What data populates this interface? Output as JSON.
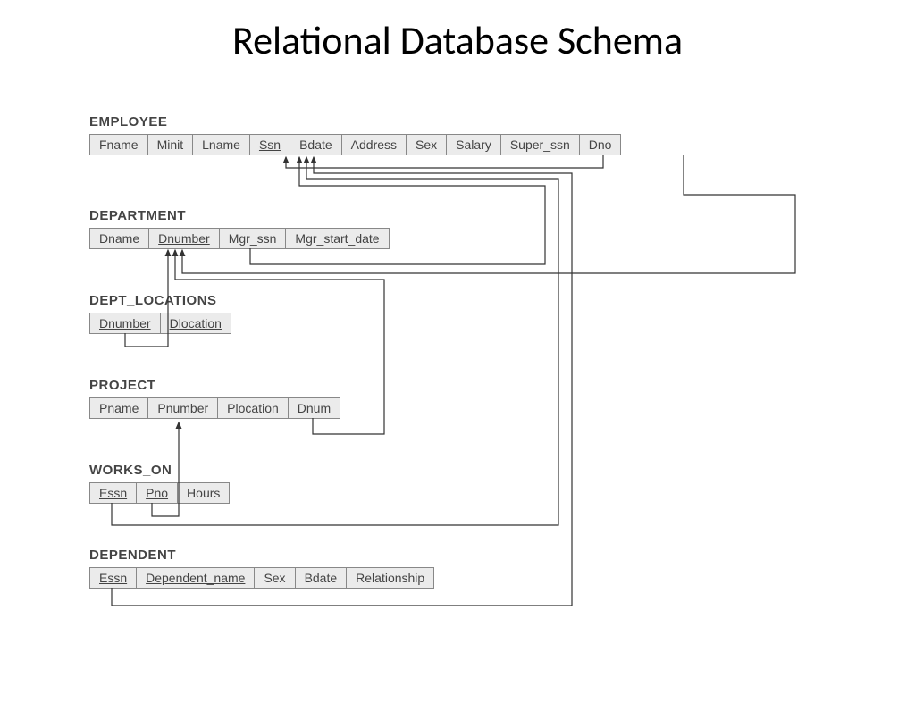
{
  "title": "Relational Database Schema",
  "tables": {
    "employee": {
      "name": "EMPLOYEE",
      "cols": [
        "Fname",
        "Minit",
        "Lname",
        "Ssn",
        "Bdate",
        "Address",
        "Sex",
        "Salary",
        "Super_ssn",
        "Dno"
      ],
      "pk": [
        "Ssn"
      ]
    },
    "department": {
      "name": "DEPARTMENT",
      "cols": [
        "Dname",
        "Dnumber",
        "Mgr_ssn",
        "Mgr_start_date"
      ],
      "pk": [
        "Dnumber"
      ]
    },
    "dept_locations": {
      "name": "DEPT_LOCATIONS",
      "cols": [
        "Dnumber",
        "Dlocation"
      ],
      "pk": [
        "Dnumber",
        "Dlocation"
      ]
    },
    "project": {
      "name": "PROJECT",
      "cols": [
        "Pname",
        "Pnumber",
        "Plocation",
        "Dnum"
      ],
      "pk": [
        "Pnumber"
      ]
    },
    "works_on": {
      "name": "WORKS_ON",
      "cols": [
        "Essn",
        "Pno",
        "Hours"
      ],
      "pk": [
        "Essn",
        "Pno"
      ]
    },
    "dependent": {
      "name": "DEPENDENT",
      "cols": [
        "Essn",
        "Dependent_name",
        "Sex",
        "Bdate",
        "Relationship"
      ],
      "pk": [
        "Essn",
        "Dependent_name"
      ]
    }
  },
  "foreign_keys": [
    {
      "from_table": "EMPLOYEE",
      "from_col": "Super_ssn",
      "to_table": "EMPLOYEE",
      "to_col": "Ssn"
    },
    {
      "from_table": "EMPLOYEE",
      "from_col": "Dno",
      "to_table": "DEPARTMENT",
      "to_col": "Dnumber"
    },
    {
      "from_table": "DEPARTMENT",
      "from_col": "Mgr_ssn",
      "to_table": "EMPLOYEE",
      "to_col": "Ssn"
    },
    {
      "from_table": "DEPT_LOCATIONS",
      "from_col": "Dnumber",
      "to_table": "DEPARTMENT",
      "to_col": "Dnumber"
    },
    {
      "from_table": "PROJECT",
      "from_col": "Dnum",
      "to_table": "DEPARTMENT",
      "to_col": "Dnumber"
    },
    {
      "from_table": "WORKS_ON",
      "from_col": "Essn",
      "to_table": "EMPLOYEE",
      "to_col": "Ssn"
    },
    {
      "from_table": "WORKS_ON",
      "from_col": "Pno",
      "to_table": "PROJECT",
      "to_col": "Pnumber"
    },
    {
      "from_table": "DEPENDENT",
      "from_col": "Essn",
      "to_table": "EMPLOYEE",
      "to_col": "Ssn"
    }
  ]
}
